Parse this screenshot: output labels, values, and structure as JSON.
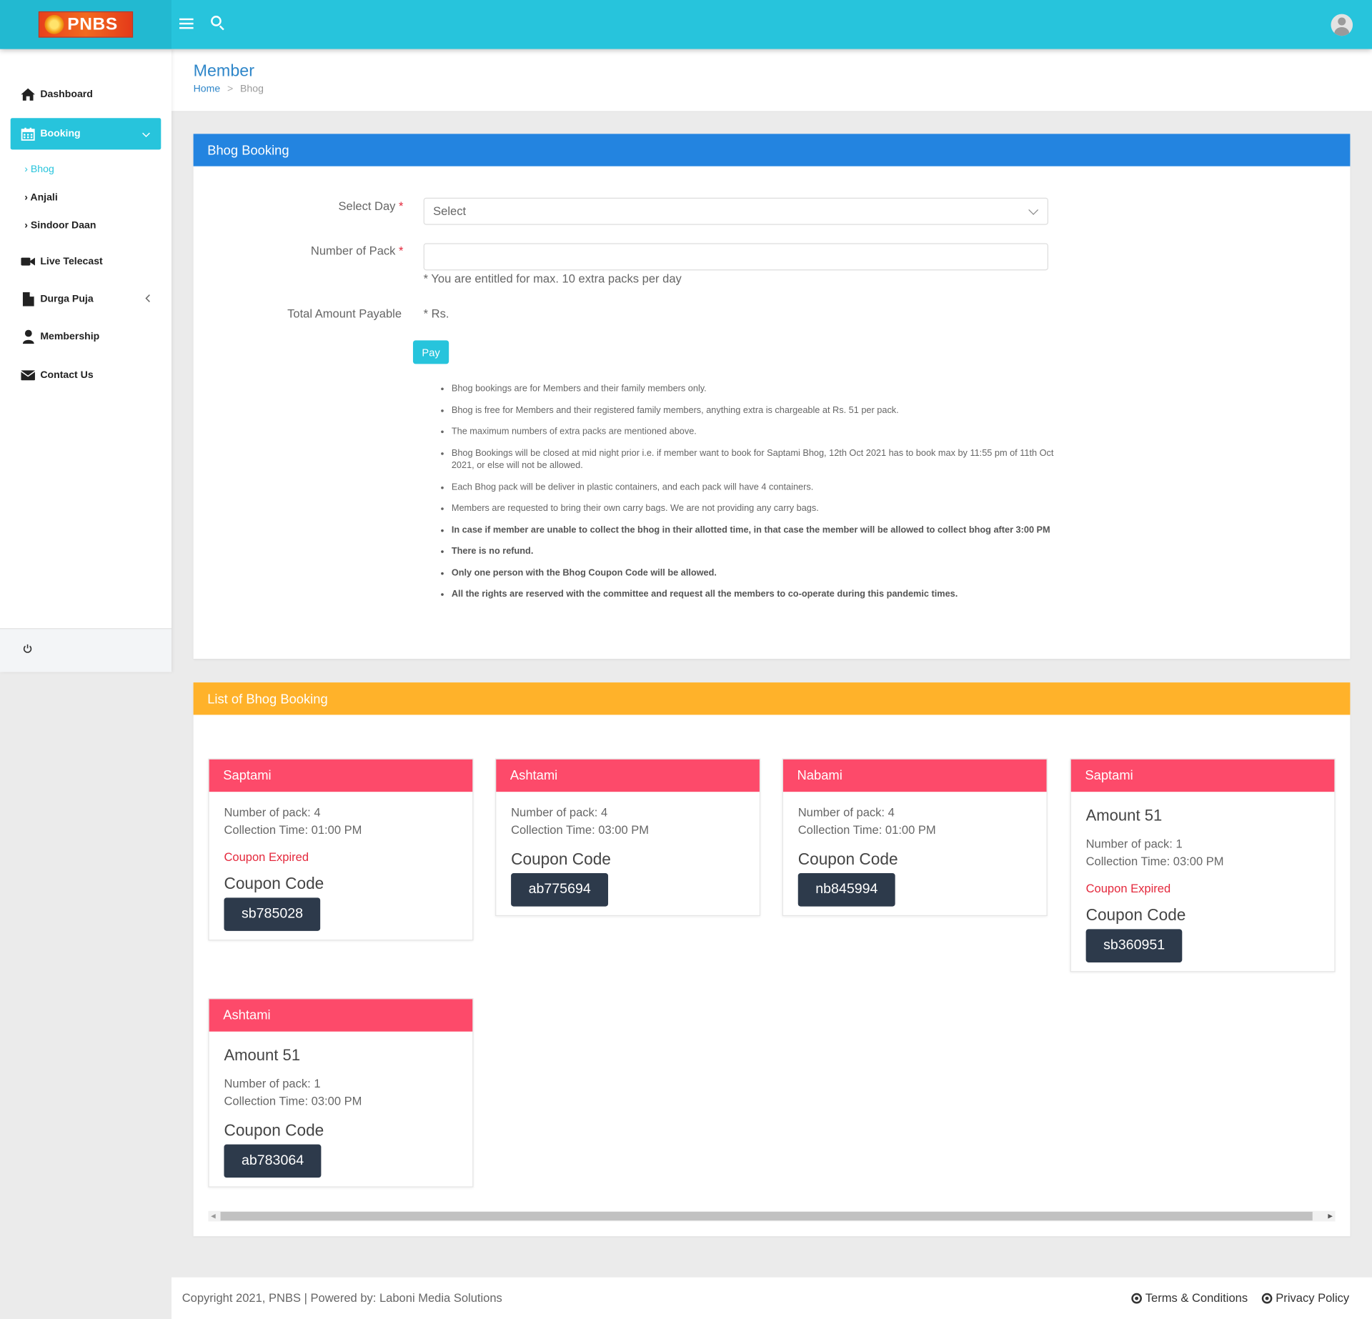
{
  "brand": {
    "logo_text": "PNBS"
  },
  "topbar": {
    "menu_icon": "hamburger-icon",
    "search_icon": "search-icon",
    "avatar_icon": "user-avatar-icon"
  },
  "sidebar": {
    "items": [
      {
        "label": "Dashboard",
        "icon": "home-icon"
      },
      {
        "label": "Booking",
        "icon": "calendar-icon"
      },
      {
        "label": "Live Telecast",
        "icon": "video-camera-icon"
      },
      {
        "label": "Durga Puja",
        "icon": "document-icon"
      },
      {
        "label": "Membership",
        "icon": "user-icon"
      },
      {
        "label": "Contact Us",
        "icon": "envelope-icon"
      }
    ],
    "subitems": [
      {
        "label": "Bhog"
      },
      {
        "label": "Anjali"
      },
      {
        "label": "Sindoor Daan"
      }
    ],
    "submenu_marker": "›",
    "power_icon": "power-icon"
  },
  "page": {
    "title": "Member",
    "breadcrumb": {
      "home": "Home",
      "separator": ">",
      "current": "Bhog"
    }
  },
  "booking_form": {
    "title": "Bhog Booking",
    "select_day_label": "Select Day",
    "select_day_value": "Select",
    "pack_label": "Number of Pack",
    "required_mark": "*",
    "hint": "* You are entitled for max. 10 extra packs per day",
    "total_label": "Total Amount Payable",
    "total_value": "* Rs.",
    "pay_label": "Pay",
    "rules": [
      {
        "text": "Bhog bookings are for Members and their family members only.",
        "bold": false
      },
      {
        "text": "Bhog is free for Members and their registered family members, anything extra is chargeable at Rs. 51 per pack.",
        "bold": false
      },
      {
        "text": "The maximum numbers of extra packs are mentioned above.",
        "bold": false
      },
      {
        "text": "Bhog Bookings will be closed at mid night prior i.e. if member want to book for Saptami Bhog, 12th Oct 2021 has to book max by 11:55 pm of 11th Oct 2021, or else will not be allowed.",
        "bold": false
      },
      {
        "text": "Each Bhog pack will be deliver in plastic containers, and each pack will have 4 containers.",
        "bold": false
      },
      {
        "text": "Members are requested to bring their own carry bags. We are not providing any carry bags.",
        "bold": false
      },
      {
        "text": "In case if member are unable to collect the bhog in their allotted time, in that case the member will be allowed to collect bhog after 3:00 PM",
        "bold": true
      },
      {
        "text": "There is no refund.",
        "bold": true
      },
      {
        "text": "Only one person with the Bhog Coupon Code will be allowed.",
        "bold": true
      },
      {
        "text": "All the rights are reserved with the committee and request all the members to co-operate during this pandemic times.",
        "bold": true
      }
    ]
  },
  "booking_list": {
    "title": "List of Bhog Booking",
    "coupon_label": "Coupon Code",
    "items": [
      {
        "day": "Saptami",
        "amount": "",
        "packs": "Number of pack: 4",
        "time": "Collection Time: 01:00 PM",
        "status": "Coupon Expired",
        "code": "sb785028"
      },
      {
        "day": "Ashtami",
        "amount": "",
        "packs": "Number of pack: 4",
        "time": "Collection Time: 03:00 PM",
        "status": "",
        "code": "ab775694"
      },
      {
        "day": "Nabami",
        "amount": "",
        "packs": "Number of pack: 4",
        "time": "Collection Time: 01:00 PM",
        "status": "",
        "code": "nb845994"
      },
      {
        "day": "Saptami",
        "amount": "Amount 51",
        "packs": "Number of pack: 1",
        "time": "Collection Time: 03:00 PM",
        "status": "Coupon Expired",
        "code": "sb360951"
      },
      {
        "day": "Ashtami",
        "amount": "Amount 51",
        "packs": "Number of pack: 1",
        "time": "Collection Time: 03:00 PM",
        "status": "",
        "code": "ab783064"
      }
    ]
  },
  "footer": {
    "copyright": "Copyright 2021, PNBS | Powered by: Laboni Media Solutions",
    "terms": "Terms & Conditions",
    "privacy": "Privacy Policy"
  },
  "colors": {
    "topbar": "#27c4dc",
    "booking_header": "#2384e0",
    "list_header": "#ffb22a",
    "card_header": "#fd4a6a",
    "coupon_bg": "#2d3a4b",
    "expired": "#e4283c"
  }
}
